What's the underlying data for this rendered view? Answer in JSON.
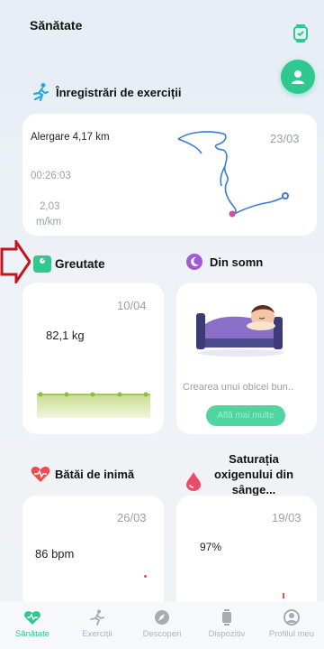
{
  "header": {
    "title": "Sănătate"
  },
  "icons": {
    "watch": "watch-icon",
    "profile": "profile-icon",
    "run": "running-icon",
    "weight": "scale-icon",
    "sleep": "moon-icon",
    "heart": "heart-icon",
    "drop": "drop-icon"
  },
  "colors": {
    "accent": "#2fc88f",
    "route": "#3a7bd5",
    "arrow": "#c0161c"
  },
  "exercise": {
    "title": "Înregistrări de exerciții",
    "activity": "Alergare 4,17 km",
    "date": "23/03",
    "duration": "00:26:03",
    "pace_value": "2,03",
    "pace_unit": "m/km"
  },
  "weight": {
    "title": "Greutate",
    "date": "10/04",
    "value": "82,1 kg"
  },
  "sleep": {
    "title": "Din somn",
    "text": "Crearea unui obicei bun..",
    "button": "Află mai multe"
  },
  "heart": {
    "title": "Bătăi de inimă",
    "date": "26/03",
    "value": "86 bpm"
  },
  "oxygen": {
    "title": "Saturația oxigenului din sânge...",
    "date": "19/03",
    "value": "97%"
  },
  "nav": {
    "items": [
      {
        "label": "Sănătate",
        "active": true
      },
      {
        "label": "Exerciții",
        "active": false
      },
      {
        "label": "Descoperi",
        "active": false
      },
      {
        "label": "Dispozitiv",
        "active": false
      },
      {
        "label": "Profilul meu",
        "active": false
      }
    ]
  }
}
